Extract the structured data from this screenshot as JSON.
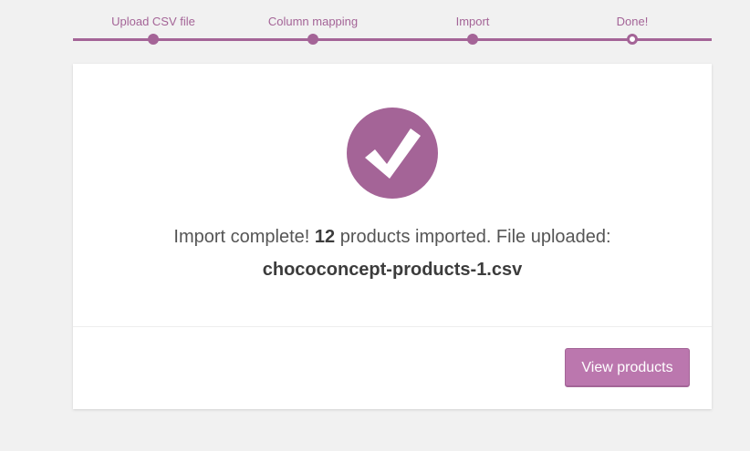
{
  "steps": [
    {
      "label": "Upload CSV file",
      "state": "done"
    },
    {
      "label": "Column mapping",
      "state": "done"
    },
    {
      "label": "Import",
      "state": "done"
    },
    {
      "label": "Done!",
      "state": "current"
    }
  ],
  "result": {
    "icon": "checkmark-icon",
    "prefix": "Import complete!",
    "count": "12",
    "middle": "products imported. File uploaded:",
    "filename": "chococoncept-products-1.csv"
  },
  "actions": {
    "view_products_label": "View products"
  },
  "colors": {
    "accent": "#a46497",
    "button": "#bb77ae",
    "background": "#f1f1f1"
  }
}
